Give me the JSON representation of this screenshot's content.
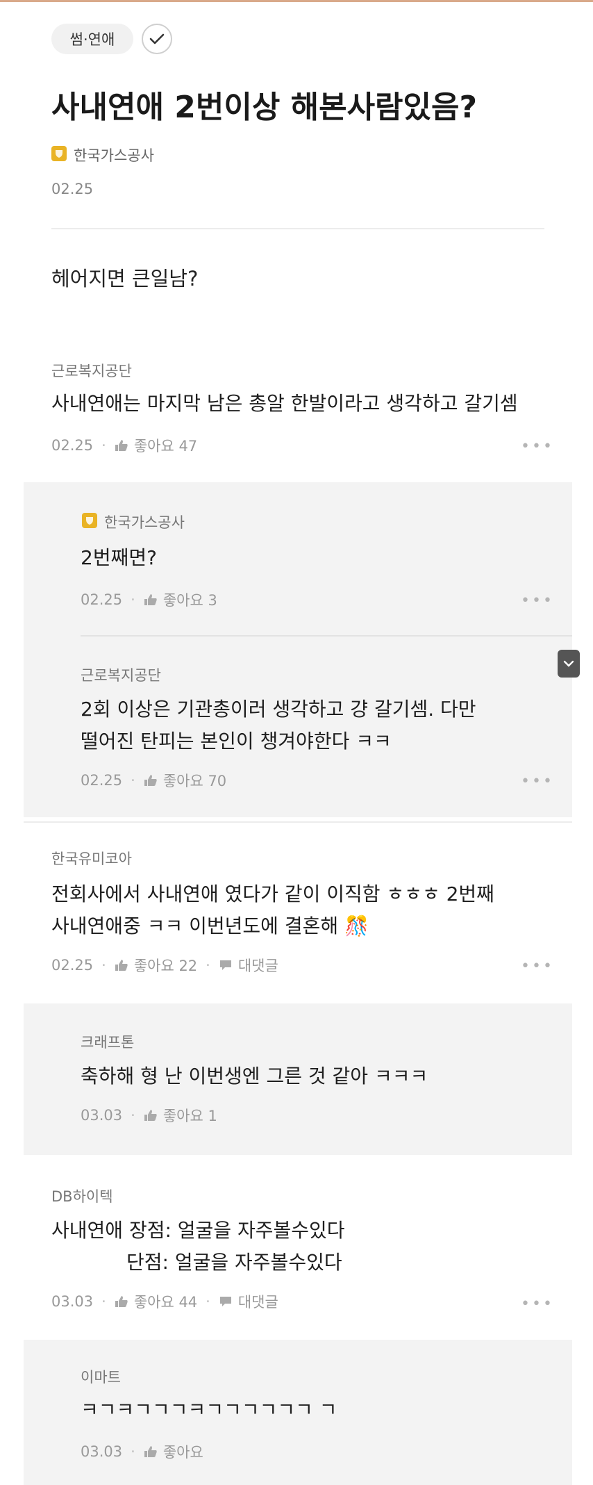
{
  "header": {
    "category_chip": "썸·연애",
    "title": "사내연애 2번이상 해본사람있음?",
    "author_company": "한국가스공사",
    "date": "02.25",
    "body": "헤어지면 큰일남?"
  },
  "comments": [
    {
      "company": "근로복지공단",
      "lines": [
        "사내연애는 마지막 남은 총알 한발이라고 생각하고 갈기셈"
      ],
      "date": "02.25",
      "likes": "좋아요 47",
      "replies": [
        {
          "company": "한국가스공사",
          "author_badge": true,
          "lines": [
            "2번째면?"
          ],
          "date": "02.25",
          "likes": "좋아요 3"
        },
        {
          "company": "근로복지공단",
          "lines": [
            "2회 이상은 기관총이러 생각하고 걍 갈기셈. 다만",
            "떨어진 탄피는 본인이 챙겨야한다 ㅋㅋ"
          ],
          "date": "02.25",
          "likes": "좋아요 70"
        }
      ]
    },
    {
      "company": "한국유미코아",
      "lines": [
        "전회사에서 사내연애 였다가 같이 이직함 ㅎㅎㅎ 2번째",
        "사내연애중 ㅋㅋ 이번년도에 결혼해 🎊"
      ],
      "date": "02.25",
      "likes": "좋아요 22",
      "reply_label": "대댓글",
      "replies": [
        {
          "company": "크래프톤",
          "lines": [
            "축하해 형  난 이번생엔 그른 것 같아 ㅋㅋㅋ"
          ],
          "date": "03.03",
          "likes": "좋아요 1"
        }
      ]
    },
    {
      "company": "DB하이텍",
      "lines": [
        "사내연애 장점: 얼굴을 자주볼수있다",
        "단점: 얼굴을 자주볼수있다"
      ],
      "date": "03.03",
      "likes": "좋아요 44",
      "reply_label": "대댓글",
      "replies": [
        {
          "company": "이마트",
          "lines": [
            "ㅋㄱㅋㄱㄱㄱㅋㄱㄱㄱㄱㄱㄱ ㄱ"
          ],
          "date": "03.03",
          "likes": "좋아요"
        }
      ]
    }
  ],
  "icons": {
    "more": "more-horizontal-icon",
    "like": "thumbs-up-icon",
    "reply": "speech-bubble-icon",
    "check": "checkmark-icon",
    "scroll": "chevron-down-icon"
  },
  "colors": {
    "badge": "#e9b325",
    "reply_bg": "#f3f3f3"
  }
}
